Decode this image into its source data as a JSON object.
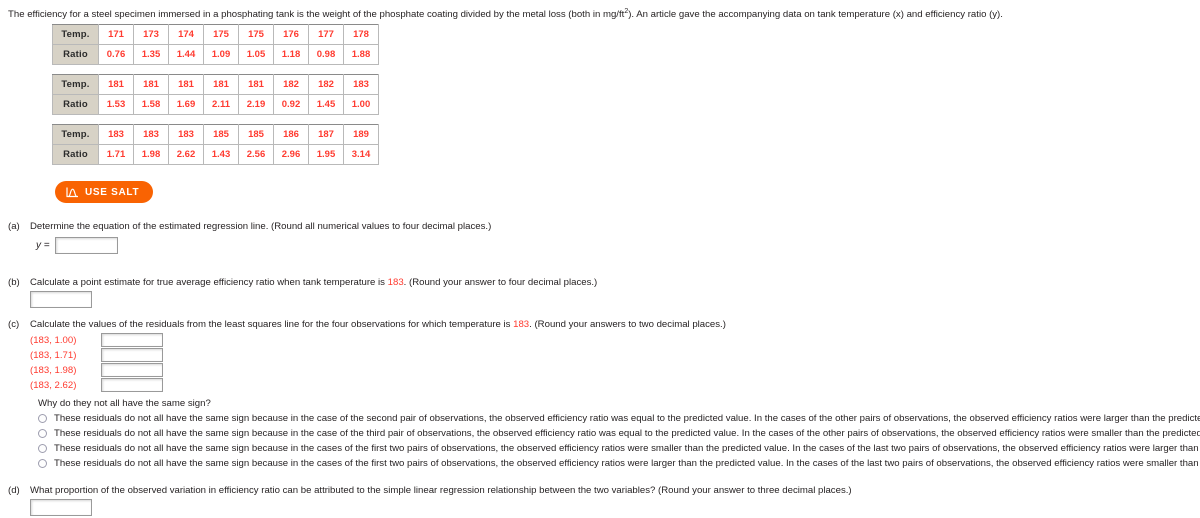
{
  "intro": {
    "text_before_sup": "The efficiency for a steel specimen immersed in a phosphating tank is the weight of the phosphate coating divided by the metal loss (both in mg/ft",
    "sup": "2",
    "text_after_sup": "). An article gave the accompanying data on tank temperature (x) and efficiency ratio (y)."
  },
  "tables": [
    {
      "row_labels": [
        "Temp.",
        "Ratio"
      ],
      "temp": [
        "171",
        "173",
        "174",
        "175",
        "175",
        "176",
        "177",
        "178"
      ],
      "ratio": [
        "0.76",
        "1.35",
        "1.44",
        "1.09",
        "1.05",
        "1.18",
        "0.98",
        "1.88"
      ]
    },
    {
      "row_labels": [
        "Temp.",
        "Ratio"
      ],
      "temp": [
        "181",
        "181",
        "181",
        "181",
        "181",
        "182",
        "182",
        "183"
      ],
      "ratio": [
        "1.53",
        "1.58",
        "1.69",
        "2.11",
        "2.19",
        "0.92",
        "1.45",
        "1.00"
      ]
    },
    {
      "row_labels": [
        "Temp.",
        "Ratio"
      ],
      "temp": [
        "183",
        "183",
        "183",
        "185",
        "185",
        "186",
        "187",
        "189"
      ],
      "ratio": [
        "1.71",
        "1.98",
        "2.62",
        "1.43",
        "2.56",
        "2.96",
        "1.95",
        "3.14"
      ]
    }
  ],
  "salt_button": {
    "label": "USE SALT",
    "icon": "distribution-curve-icon",
    "color": "#f96302"
  },
  "questions": {
    "a": {
      "label": "(a)",
      "text": "Determine the equation of the estimated regression line. (Round all numerical values to four decimal places.)",
      "y_label": "y =",
      "value": ""
    },
    "b": {
      "label": "(b)",
      "text_1": "Calculate a point estimate for true average efficiency ratio when tank temperature is ",
      "highlight": "183",
      "text_2": ". (Round your answer to four decimal places.)",
      "value": ""
    },
    "c": {
      "label": "(c)",
      "text_1": "Calculate the values of the residuals from the least squares line for the four observations for which temperature is ",
      "highlight": "183",
      "text_2": ". (Round your answers to two decimal places.)",
      "residuals": [
        {
          "pair": "(183, 1.00)",
          "value": ""
        },
        {
          "pair": "(183, 1.71)",
          "value": ""
        },
        {
          "pair": "(183, 1.98)",
          "value": ""
        },
        {
          "pair": "(183, 2.62)",
          "value": ""
        }
      ],
      "why_prompt": "Why do they not all have the same sign?",
      "options": [
        "These residuals do not all have the same sign because in the case of the second pair of observations, the observed efficiency ratio was equal to the predicted value. In the cases of the other pairs of observations, the observed efficiency ratios were larger than the predicted value.",
        "These residuals do not all have the same sign because in the case of the third pair of observations, the observed efficiency ratio was equal to the predicted value. In the cases of the other pairs of observations, the observed efficiency ratios were smaller than the predicted value.",
        "These residuals do not all have the same sign because in the cases of the first two pairs of observations, the observed efficiency ratios were smaller than the predicted value. In the cases of the last two pairs of observations, the observed efficiency ratios were larger than the predicted value.",
        "These residuals do not all have the same sign because in the cases of the first two pairs of observations, the observed efficiency ratios were larger than the predicted value. In the cases of the last two pairs of observations, the observed efficiency ratios were smaller than the predicted value."
      ],
      "selected_option": null
    },
    "d": {
      "label": "(d)",
      "text": "What proportion of the observed variation in efficiency ratio can be attributed to the simple linear regression relationship between the two variables? (Round your answer to three decimal places.)",
      "value": ""
    }
  }
}
